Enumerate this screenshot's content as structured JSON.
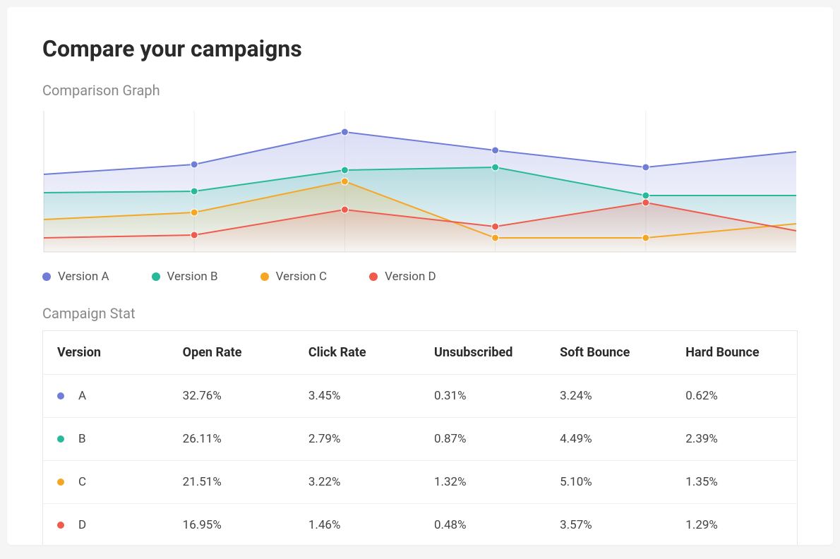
{
  "title": "Compare your campaigns",
  "sections": {
    "graph_label": "Comparison Graph",
    "stat_label": "Campaign Stat"
  },
  "colors": {
    "versionA": "#6f7dd8",
    "versionB": "#26b99a",
    "versionC": "#f5a623",
    "versionD": "#ef5b4c"
  },
  "legend": [
    {
      "label": "Version A",
      "colorKey": "versionA"
    },
    {
      "label": "Version B",
      "colorKey": "versionB"
    },
    {
      "label": "Version C",
      "colorKey": "versionC"
    },
    {
      "label": "Version D",
      "colorKey": "versionD"
    }
  ],
  "table": {
    "headers": [
      "Version",
      "Open Rate",
      "Click Rate",
      "Unsubscribed",
      "Soft Bounce",
      "Hard Bounce"
    ],
    "rows": [
      {
        "colorKey": "versionA",
        "version": "A",
        "open": "32.76%",
        "click": "3.45%",
        "unsub": "0.31%",
        "soft": "3.24%",
        "hard": "0.62%"
      },
      {
        "colorKey": "versionB",
        "version": "B",
        "open": "26.11%",
        "click": "2.79%",
        "unsub": "0.87%",
        "soft": "4.49%",
        "hard": "2.39%"
      },
      {
        "colorKey": "versionC",
        "version": "C",
        "open": "21.51%",
        "click": "3.22%",
        "unsub": "1.32%",
        "soft": "5.10%",
        "hard": "1.35%"
      },
      {
        "colorKey": "versionD",
        "version": "D",
        "open": "16.95%",
        "click": "1.46%",
        "unsub": "0.48%",
        "soft": "3.57%",
        "hard": "1.29%"
      }
    ]
  },
  "chart_data": {
    "type": "area",
    "title": "Comparison Graph",
    "x": [
      0,
      1,
      2,
      3,
      4,
      5
    ],
    "ylim": [
      0,
      100
    ],
    "series": [
      {
        "name": "Version A",
        "colorKey": "versionA",
        "values": [
          55,
          62,
          85,
          72,
          60,
          71
        ]
      },
      {
        "name": "Version B",
        "colorKey": "versionB",
        "values": [
          42,
          43,
          58,
          60,
          40,
          40
        ]
      },
      {
        "name": "Version C",
        "colorKey": "versionC",
        "values": [
          23,
          28,
          50,
          10,
          10,
          20
        ]
      },
      {
        "name": "Version D",
        "colorKey": "versionD",
        "values": [
          10,
          12,
          30,
          18,
          35,
          15
        ]
      }
    ],
    "legend_position": "bottom",
    "grid": false
  }
}
